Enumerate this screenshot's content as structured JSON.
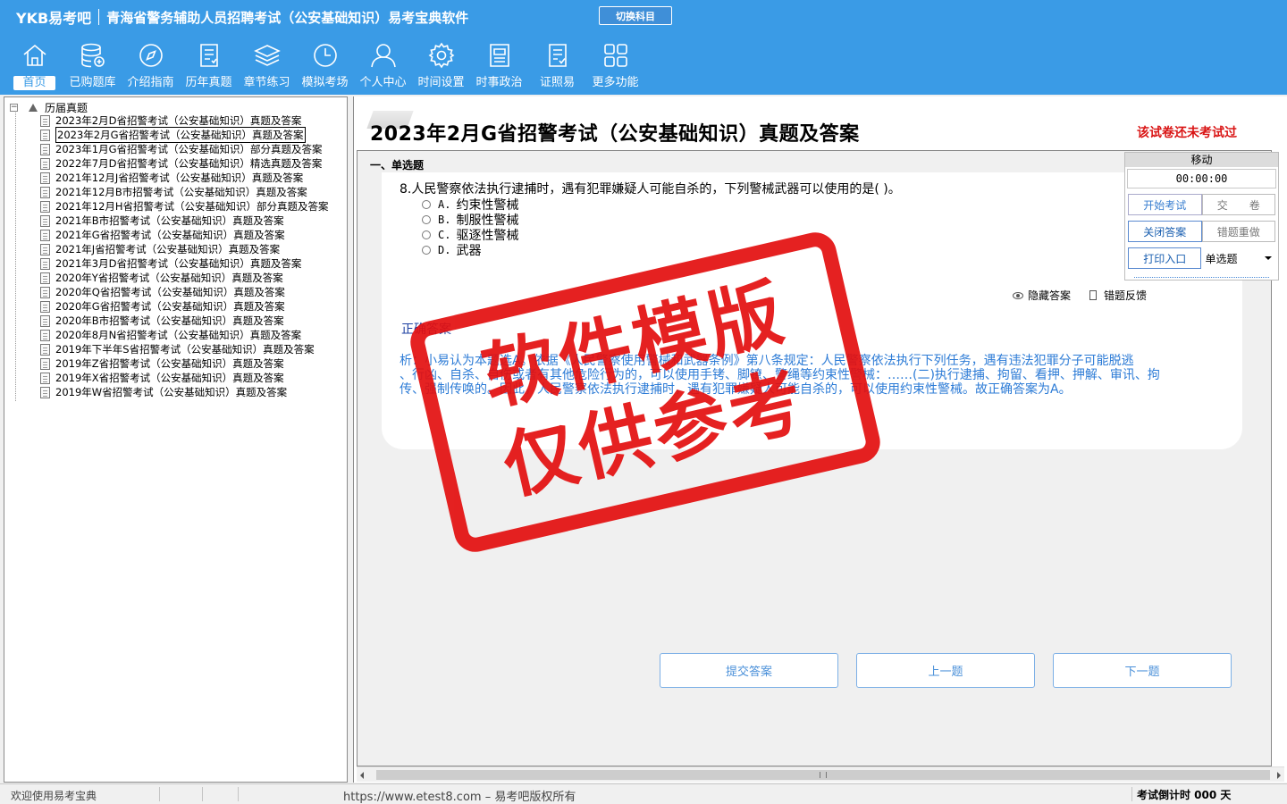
{
  "header": {
    "logo": "YKB易考吧",
    "title": "青海省警务辅助人员招聘考试（公安基础知识）易考宝典软件",
    "switch_label": "切换科目"
  },
  "nav": [
    {
      "label": "首页",
      "icon": "home-icon"
    },
    {
      "label": "已购题库",
      "icon": "database-icon"
    },
    {
      "label": "介绍指南",
      "icon": "compass-icon"
    },
    {
      "label": "历年真题",
      "icon": "document-list-icon"
    },
    {
      "label": "章节练习",
      "icon": "layers-icon"
    },
    {
      "label": "模拟考场",
      "icon": "clock-icon"
    },
    {
      "label": "个人中心",
      "icon": "user-icon"
    },
    {
      "label": "时间设置",
      "icon": "gear-icon"
    },
    {
      "label": "时事政治",
      "icon": "newspaper-icon"
    },
    {
      "label": "证照易",
      "icon": "checklist-icon"
    },
    {
      "label": "更多功能",
      "icon": "grid-icon"
    }
  ],
  "tree": {
    "root": "历届真题",
    "items": [
      "2023年2月D省招警考试（公安基础知识）真题及答案",
      "2023年2月G省招警考试（公安基础知识）真题及答案",
      "2023年1月G省招警考试（公安基础知识）部分真题及答案",
      "2022年7月D省招警考试（公安基础知识）精选真题及答案",
      "2021年12月J省招警考试（公安基础知识）真题及答案",
      "2021年12月B市招警考试（公安基础知识）真题及答案",
      "2021年12月H省招警考试（公安基础知识）部分真题及答案",
      "2021年B市招警考试（公安基础知识）真题及答案",
      "2021年G省招警考试（公安基础知识）真题及答案",
      "2021年J省招警考试（公安基础知识）真题及答案",
      "2021年3月D省招警考试（公安基础知识）真题及答案",
      "2020年Y省招警考试（公安基础知识）真题及答案",
      "2020年Q省招警考试（公安基础知识）真题及答案",
      "2020年G省招警考试（公安基础知识）真题及答案",
      "2020年B市招警考试（公安基础知识）真题及答案",
      "2020年8月N省招警考试（公安基础知识）真题及答案",
      "2019年下半年S省招警考试（公安基础知识）真题及答案",
      "2019年Z省招警考试（公安基础知识）真题及答案",
      "2019年X省招警考试（公安基础知识）真题及答案",
      "2019年W省招警考试（公安基础知识）真题及答案"
    ]
  },
  "exam": {
    "title": "2023年2月G省招警考试（公安基础知识）真题及答案",
    "status": "该试卷还未考试过",
    "section": "一、单选题",
    "question": "8.人民警察依法执行逮捕时，遇有犯罪嫌疑人可能自杀的，下列警械武器可以使用的是( )。",
    "options": [
      {
        "letter": "A.",
        "text": "约束性警械"
      },
      {
        "letter": "B.",
        "text": "制服性警械"
      },
      {
        "letter": "C.",
        "text": "驱逐性警械"
      },
      {
        "letter": "D.",
        "text": "武器"
      }
    ],
    "hide_answer": "隐藏答案",
    "feedback": "错题反馈",
    "correct_label": "正确答案",
    "analysis_line1": "析：小易认为本题选A。依据《人民警察使用警械和武器条例》第八条规定：人民警察依法执行下列任务，遇有违法犯罪分子可能脱逃",
    "analysis_line2": "、行凶、自杀、自伤或者有其他危险行为的，可以使用手铐、脚镣、警绳等约束性警械：……(二)执行逮捕、拘留、看押、押解、审讯、拘",
    "analysis_line3": "传、强制传唤的。因此，人民警察依法执行逮捕时，遇有犯罪嫌疑人可能自杀的，可以使用约束性警械。故正确答案为A。"
  },
  "control": {
    "move": "移动",
    "timer": "00:00:00",
    "start": "开始考试",
    "submit_paper": "交　　卷",
    "close_answer": "关闭答案",
    "redo_wrong": "错题重做",
    "print": "打印入口",
    "type_select": "单选题"
  },
  "buttons": {
    "submit_answer": "提交答案",
    "prev": "上一题",
    "next": "下一题"
  },
  "stamp": {
    "line1": "软件模版",
    "line2": "仅供参考"
  },
  "statusbar": {
    "welcome": "欢迎使用易考宝典",
    "copyright": "https://www.etest8.com – 易考吧版权所有",
    "countdown": "考试倒计时 000 天"
  }
}
